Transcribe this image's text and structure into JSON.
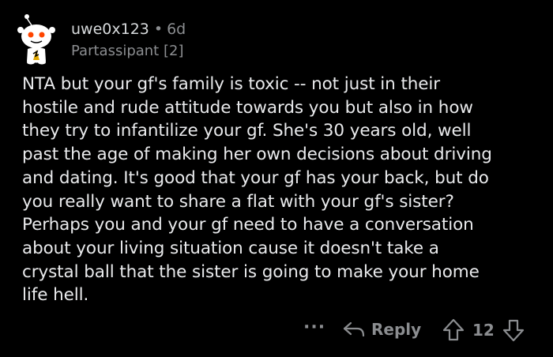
{
  "comment": {
    "username": "uwe0x123",
    "separator": "•",
    "age": "6d",
    "flair": "Partassipant [2]",
    "body": "NTA but your gf's family is toxic -- not just in their\nhostile and rude attitude towards you but also in how\nthey try to infantilize your gf. She's 30 years old, well\npast the age of making her own decisions about driving\nand dating. It's good that your gf has your back, but do\nyou really want to share a flat with your gf's sister?\nPerhaps you and your gf need to have a conversation\nabout your living situation cause it doesn't take a\ncrystal ball that the sister is going to make your home\nlife hell."
  },
  "actions": {
    "more_label": "···",
    "reply_label": "Reply",
    "score": "12"
  },
  "icons": {
    "avatar": "snoo-avatar-icon",
    "reply": "reply-arrow-icon",
    "upvote": "upvote-arrow-icon",
    "downvote": "downvote-arrow-icon"
  },
  "colors": {
    "background": "#000000",
    "text": "#e9eaec",
    "muted": "#8b8d90",
    "avatar_accent": "#ff4500"
  }
}
